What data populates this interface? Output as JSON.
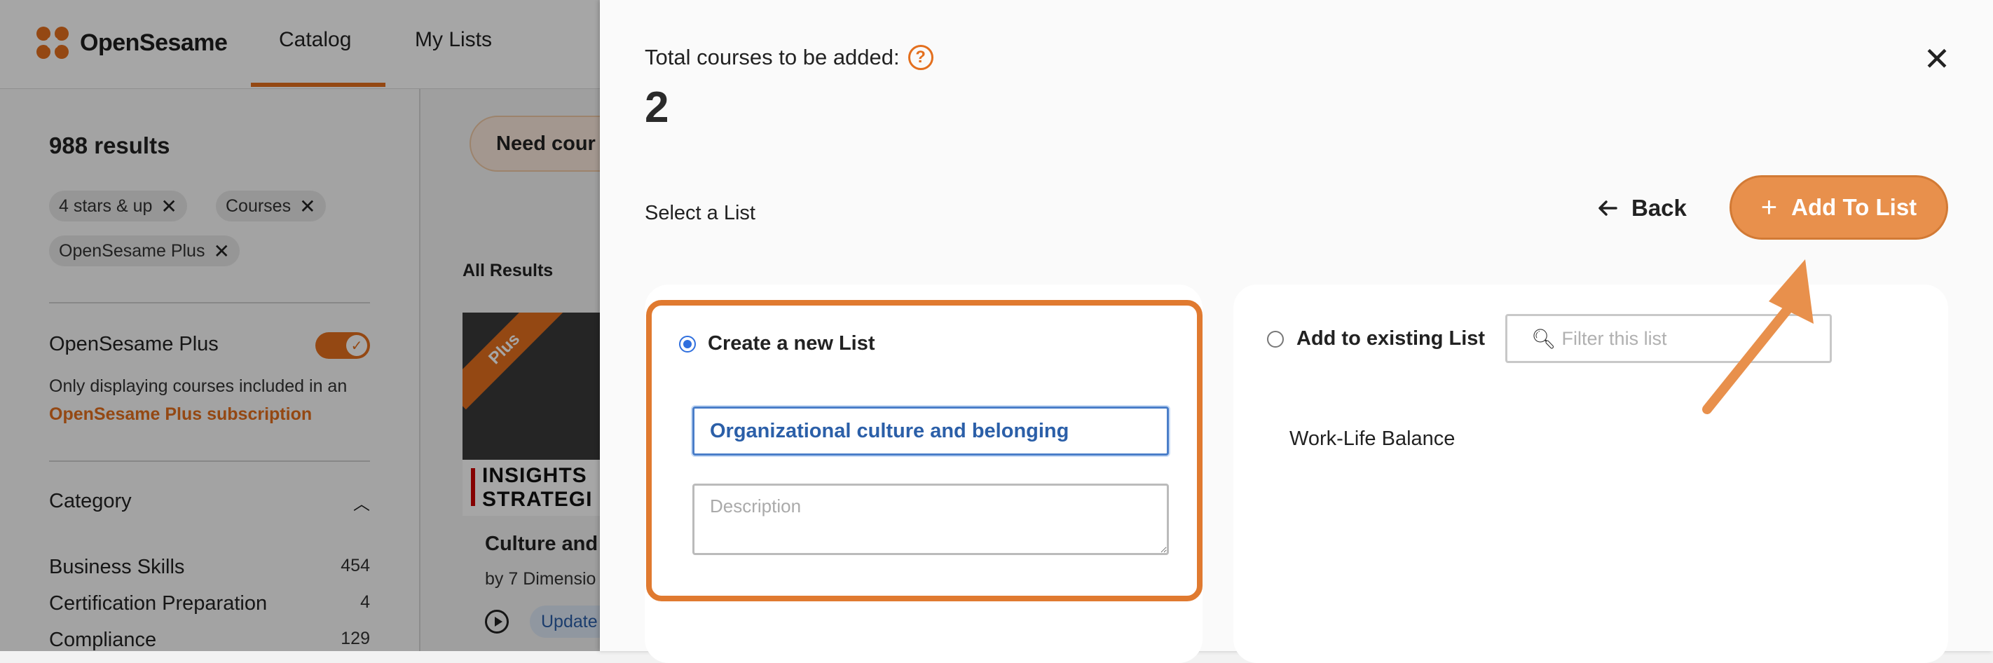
{
  "header": {
    "logo_text": "OpenSesame",
    "tabs": [
      {
        "label": "Catalog",
        "active": true
      },
      {
        "label": "My Lists",
        "active": false
      }
    ],
    "accent_color": "#e36f1e"
  },
  "sidebar": {
    "results_count": "988 results",
    "chips": [
      "4 stars & up",
      "Courses",
      "OpenSesame Plus"
    ],
    "plus_toggle_label": "OpenSesame Plus",
    "plus_toggle_on": true,
    "plus_note": "Only displaying courses included in an",
    "plus_link": "OpenSesame Plus subscription",
    "category_heading": "Category",
    "categories": [
      {
        "name": "Business Skills",
        "count": "454"
      },
      {
        "name": "Certification Preparation",
        "count": "4"
      },
      {
        "name": "Compliance",
        "count": "129"
      }
    ]
  },
  "main": {
    "need_button": "Need cour",
    "all_results": "All Results",
    "course": {
      "ribbon": "Plus",
      "thumb_line1": "INSIGHTS",
      "thumb_line2": "STRATEGI",
      "title": "Culture and",
      "by": "by 7 Dimensio",
      "badge": "Update"
    }
  },
  "panel": {
    "total_label": "Total courses to be added:",
    "help_icon": "question-circle-icon",
    "total_value": "2",
    "select_label": "Select a List",
    "back_label": "Back",
    "add_label": "Add To List",
    "create_option_label": "Create a new List",
    "create_selected": true,
    "list_name_value": "Organizational culture and belonging",
    "description_placeholder": "Description",
    "existing_option_label": "Add to existing List",
    "filter_placeholder": "Filter this list",
    "existing_lists": [
      "Work-Life Balance"
    ],
    "highlight_color": "#e07a30"
  }
}
